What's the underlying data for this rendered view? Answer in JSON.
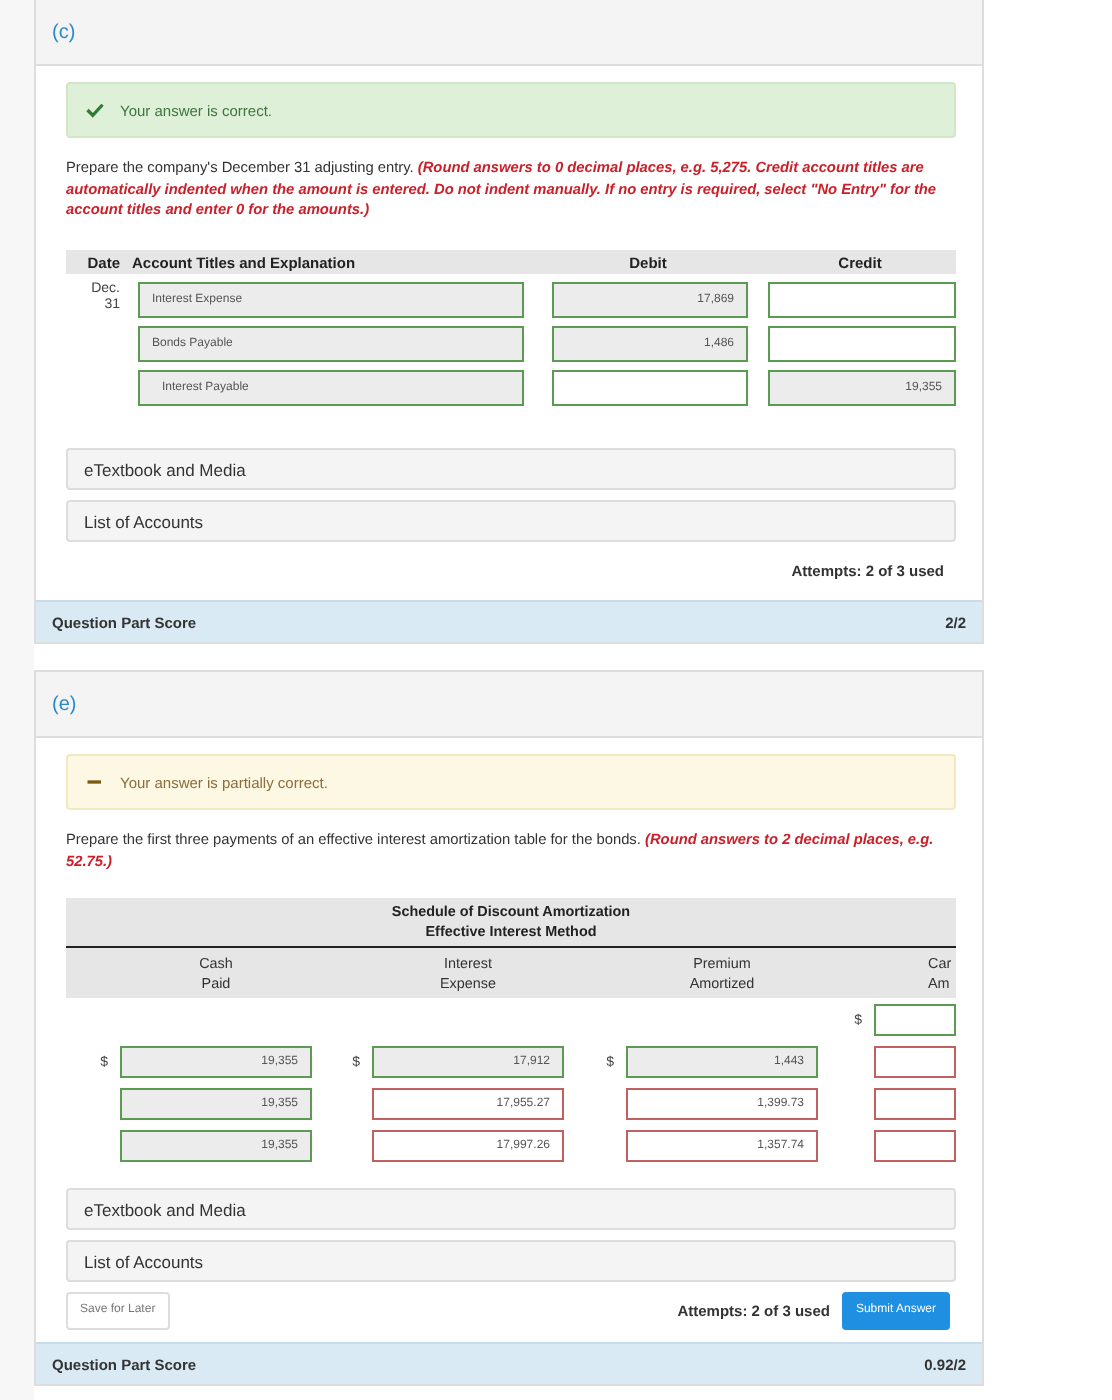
{
  "part_c": {
    "label": "(c)",
    "feedback": {
      "kind": "correct",
      "text": "Your answer is correct."
    },
    "instructions": "Prepare the company's December 31 adjusting entry. **(Round answers to 0 decimal places, e.g. 5,275. Credit account titles are automatically indented when the amount is entered. Do not indent manually. If no entry is required, select \"No Entry\" for the account titles and enter 0 for the amounts.)**",
    "journal": {
      "columns": [
        "Date",
        "Account Titles and Explanation",
        "Debit",
        "Credit"
      ],
      "rows": [
        {
          "date": "Dec. 31",
          "account": {
            "value": "Interest Expense",
            "correct": true,
            "indented": false
          },
          "debit": {
            "value": "17,869",
            "correct": true
          },
          "credit": {
            "correct": true
          }
        },
        {
          "account": {
            "value": "Bonds Payable",
            "correct": true,
            "indented": false
          },
          "debit": {
            "value": "1,486",
            "correct": true
          },
          "credit": {
            "correct": true
          }
        },
        {
          "account": {
            "value": "Interest Payable",
            "correct": true,
            "indented": true
          },
          "debit": {
            "correct": true
          },
          "credit": {
            "value": "19,355",
            "correct": true
          }
        }
      ]
    },
    "links": [
      "eTextbook and Media",
      "List of Accounts"
    ],
    "attempts": "Attempts: 2 of 3 used",
    "score": {
      "label": "Question Part Score",
      "value": "2/2"
    }
  },
  "part_e": {
    "label": "(e)",
    "feedback": {
      "kind": "partial",
      "text": "Your answer is partially correct."
    },
    "instructions": "Prepare the first three payments of an effective interest amortization table for the bonds. **(Round answers to 2 decimal places, e.g. 52.75.)**",
    "table": {
      "title": "Schedule of Discount Amortization",
      "subtitle": "Effective Interest Method",
      "columns": [
        "Cash\nPaid",
        "Interest\nExpense",
        "Premium\nAmortized",
        "Car\nAm"
      ],
      "rows": [
        {
          "cells": [
            {
              "kind": "empty"
            },
            {
              "kind": "empty"
            },
            {
              "kind": "empty"
            },
            {
              "kind": "field",
              "currency": "$",
              "correct": true
            }
          ]
        },
        {
          "cells": [
            {
              "kind": "field",
              "currency": "$",
              "value": "19,355",
              "correct": true
            },
            {
              "kind": "field",
              "currency": "$",
              "value": "17,912",
              "correct": true
            },
            {
              "kind": "field",
              "currency": "$",
              "value": "1,443",
              "correct": true
            },
            {
              "kind": "field",
              "correct": false
            }
          ]
        },
        {
          "cells": [
            {
              "kind": "field",
              "value": "19,355",
              "correct": true
            },
            {
              "kind": "field",
              "value": "17,955.27",
              "correct": false
            },
            {
              "kind": "field",
              "value": "1,399.73",
              "correct": false
            },
            {
              "kind": "field",
              "correct": false
            }
          ]
        },
        {
          "cells": [
            {
              "kind": "field",
              "value": "19,355",
              "correct": true
            },
            {
              "kind": "field",
              "value": "17,997.26",
              "correct": false
            },
            {
              "kind": "field",
              "value": "1,357.74",
              "correct": false
            },
            {
              "kind": "field",
              "correct": false
            }
          ]
        }
      ]
    },
    "links": [
      "eTextbook and Media",
      "List of Accounts"
    ],
    "save_button": "Save for Later",
    "attempts": "Attempts: 2 of 3 used",
    "submit_button": "Submit Answer",
    "score": {
      "label": "Question Part Score",
      "value": "0.92/2"
    }
  }
}
